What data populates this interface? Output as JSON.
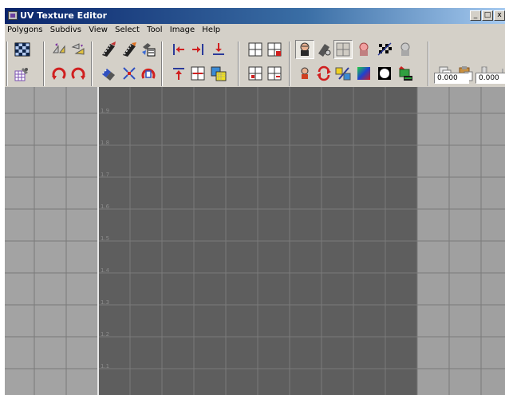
{
  "window": {
    "title": "UV Texture Editor"
  },
  "title_buttons": {
    "minimize": "_",
    "maximize": "□",
    "close": "x"
  },
  "menu": [
    "Polygons",
    "Subdivs",
    "View",
    "Select",
    "Tool",
    "Image",
    "Help"
  ],
  "coords": {
    "u": "0.000",
    "v": "0.000"
  },
  "ticks": [
    "1.9",
    "1.8",
    "1.7",
    "1.6",
    "1.5",
    "1.4",
    "1.3",
    "1.2",
    "1.1"
  ],
  "colors": {
    "viewport_bg": "#5e5e5e",
    "viewport_outer": "#a3a3a3",
    "title_bar": "#0a246a"
  }
}
